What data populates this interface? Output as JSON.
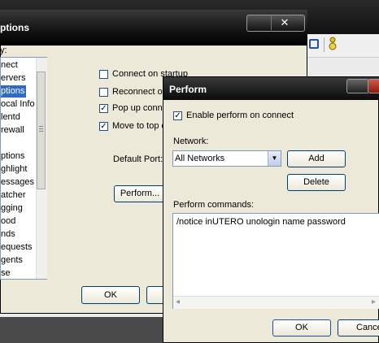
{
  "options_window": {
    "title": "ptions",
    "close_glyph": "✕",
    "category_label": "y:",
    "tree_items": [
      {
        "label": "nect",
        "selected": false
      },
      {
        "label": "ervers",
        "selected": false
      },
      {
        "label": "ptions",
        "selected": true
      },
      {
        "label": "ocal Info",
        "selected": false
      },
      {
        "label": "lentd",
        "selected": false
      },
      {
        "label": "rewall",
        "selected": false
      },
      {
        "label": "",
        "selected": false
      },
      {
        "label": "ptions",
        "selected": false
      },
      {
        "label": "ghlight",
        "selected": false
      },
      {
        "label": "essages",
        "selected": false
      },
      {
        "label": "atcher",
        "selected": false
      },
      {
        "label": "gging",
        "selected": false
      },
      {
        "label": "ood",
        "selected": false
      },
      {
        "label": "nds",
        "selected": false
      },
      {
        "label": "equests",
        "selected": false
      },
      {
        "label": "gents",
        "selected": false
      },
      {
        "label": "se",
        "selected": false
      }
    ],
    "checkboxes": [
      {
        "label": "Connect on startup",
        "checked": false
      },
      {
        "label": "Reconnect on",
        "checked": false
      },
      {
        "label": "Pop up conne",
        "checked": true
      },
      {
        "label": "Move to top o",
        "checked": true
      }
    ],
    "default_port_label": "Default Port:",
    "perform_button": "Perform...",
    "ok_button": "OK"
  },
  "perform_dialog": {
    "title": "Perform",
    "enable_label": "Enable perform on connect",
    "enable_checked": true,
    "network_label": "Network:",
    "network_value": "All Networks",
    "add_button": "Add",
    "delete_button": "Delete",
    "commands_label": "Perform commands:",
    "commands_text": "/notice inUTERO unologin name password",
    "ok_button": "OK",
    "cancel_button": "Cance"
  },
  "icons": {
    "close": "✕",
    "check": "✓",
    "dropdown": "▼",
    "scroll_left": "◂",
    "scroll_right": "▸"
  }
}
